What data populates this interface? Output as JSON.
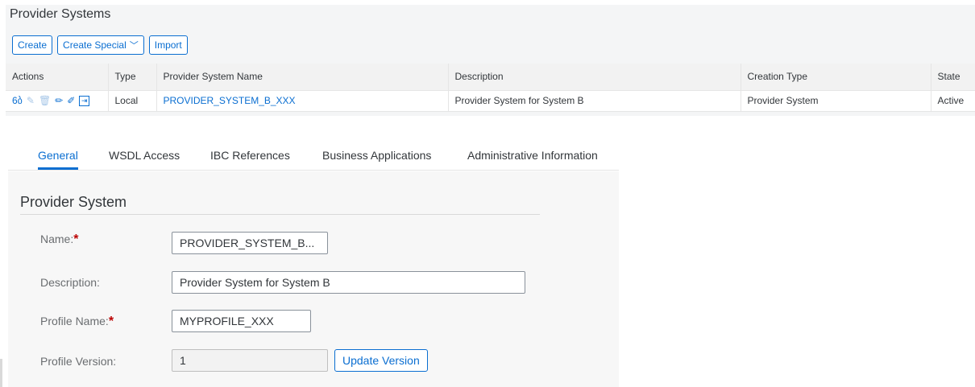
{
  "providers": {
    "title": "Provider Systems",
    "toolbar": {
      "create": "Create",
      "create_special": "Create Special",
      "import": "Import"
    },
    "columns": {
      "actions": "Actions",
      "type": "Type",
      "name": "Provider System Name",
      "description": "Description",
      "creation_type": "Creation Type",
      "state": "State"
    },
    "row": {
      "type": "Local",
      "name": "PROVIDER_SYSTEM_B_XXX",
      "description": "Provider System for System B",
      "creation_type": "Provider System",
      "state": "Active"
    },
    "action_icons": [
      "glasses-icon",
      "edit-icon",
      "delete-icon",
      "pencil-icon",
      "no-edit-icon",
      "export-icon"
    ]
  },
  "detail": {
    "tabs": {
      "general": "General",
      "wsdl": "WSDL Access",
      "ibc": "IBC References",
      "business": "Business Applications",
      "admin": "Administrative Information"
    },
    "section_title": "Provider System",
    "fields": {
      "name_label": "Name:",
      "name_value": "PROVIDER_SYSTEM_B...",
      "description_label": "Description:",
      "description_value": "Provider System for System B",
      "profile_name_label": "Profile Name:",
      "profile_name_value": "MYPROFILE_XXX",
      "profile_version_label": "Profile Version:",
      "profile_version_value": "1",
      "required_mark": "*"
    },
    "update_version": "Update Version"
  },
  "colors": {
    "accent": "#0a6ed1",
    "required": "#bb0000"
  }
}
